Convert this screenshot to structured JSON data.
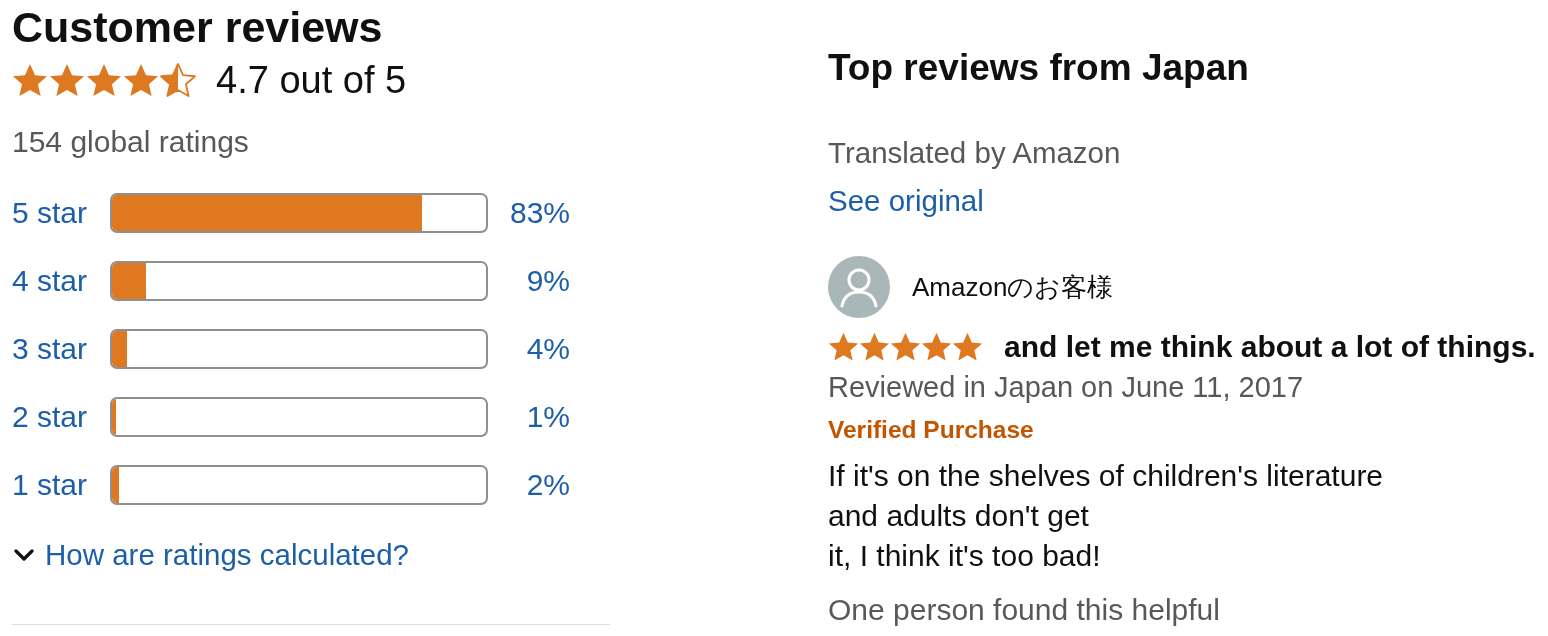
{
  "summary": {
    "title": "Customer reviews",
    "stars": 4.5,
    "rating": "4.7 out of 5",
    "global_ratings": "154 global ratings"
  },
  "histogram": [
    {
      "label": "5 star",
      "level": 0.83,
      "reading": "83%"
    },
    {
      "label": "4 star",
      "level": 0.09,
      "reading": "9%"
    },
    {
      "label": "3 star",
      "level": 0.04,
      "reading": "4%"
    },
    {
      "label": "2 star",
      "level": 0.01,
      "reading": "1%"
    },
    {
      "label": "1 star",
      "level": 0.02,
      "reading": "2%"
    }
  ],
  "ratings_help": {
    "label": "How are ratings calculated?",
    "expanded": false
  },
  "top_reviews": {
    "title": "Top reviews from Japan",
    "translation_note": "Translated by Amazon",
    "see_original": "See original",
    "reviews": [
      {
        "author": "Amazonのお客様",
        "stars": 5,
        "title": "and let me think about a lot of things.",
        "date": "Reviewed in Japan on June 11, 2017",
        "badge": "Verified Purchase",
        "body": "If it's on the shelves of children's literature\nand adults don't get\nit, I think it's too bad!",
        "helpful": "One person found this helpful"
      }
    ]
  }
}
